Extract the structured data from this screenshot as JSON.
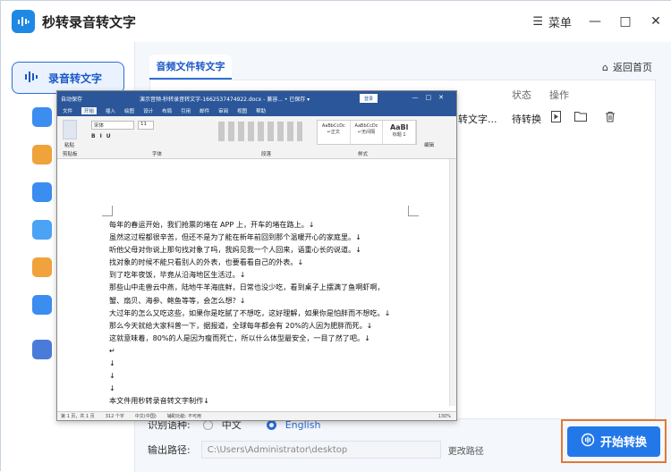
{
  "app": {
    "title": "秒转录音转文字",
    "menu_label": "菜单"
  },
  "window_controls": {
    "minimize": "—",
    "maximize": "□",
    "close": "✕"
  },
  "sidebar": {
    "active_label": "录音转文字"
  },
  "main": {
    "tab_label": "音频文件转文字",
    "home_label": "返回首页",
    "table": {
      "headers": {
        "status": "状态",
        "action": "操作"
      },
      "row": {
        "name": "转文字...",
        "status": "待转换"
      }
    },
    "language": {
      "label": "识别语种:",
      "options": [
        "中文",
        "English"
      ],
      "selected": "English"
    },
    "output": {
      "label": "输出路径:",
      "path": "C:\\Users\\Administrator\\desktop",
      "change": "更改路径"
    },
    "start_label": "开始转换"
  },
  "word": {
    "autosave": "自动保存",
    "doc_title": "演示音频-秒转录音转文字-1662537474922.docx - 兼容... • 已保存 ▾",
    "login": "登录",
    "menu": [
      "文件",
      "开始",
      "插入",
      "绘图",
      "设计",
      "布局",
      "引用",
      "邮件",
      "审阅",
      "视图",
      "帮助"
    ],
    "active_menu": "开始",
    "ribbon": {
      "paste": "粘贴",
      "font": "宋体",
      "size": "11",
      "groups": [
        "剪贴板",
        "字体",
        "段落",
        "样式",
        "编辑"
      ],
      "styles": [
        {
          "sample": "AaBbCcDc",
          "name": "↵正文"
        },
        {
          "sample": "AaBbCcDc",
          "name": "↵无间隔"
        },
        {
          "sample": "AaBl",
          "name": "标题 1"
        }
      ],
      "edit": "编辑"
    },
    "lines": [
      "每年的春运开始，我们抢票的堵在 APP 上，开车的堵在路上。↓",
      "虽然这过程都很辛苦，但还不是为了能在新年前回到那个温暖开心的家庭里。↓",
      "听他父母对你说上那句找对象了吗，我妈见我一个人回来，语重心长的说道。↓",
      "找对象的时候不能只看别人的外表，也要看看自己的外表。↓",
      "到了吃年夜饭，毕竟从沿海地区生活过。↓",
      "那些山中走兽云中燕，陆地牛羊海底鲜，日常也没少吃，看到桌子上摆满了鱼啊虾啊，",
      "蟹、扇贝、海参、鲍鱼等等，会怎么想？↓",
      "大过年的怎么又吃这些，如果你是吃腻了不想吃，这好理解，如果你是怕胖而不想吃。↓",
      "那么今天就给大家科普一下，据报道，全球每年都会有 20%的人因为肥胖而死。↓",
      "这就意味着，80%的人是因为瘦而死亡，所以什么体型最安全，一目了然了吧。↓",
      "↵",
      "↓",
      "↓",
      "↓",
      "本文件用秒转录音转文字制作↓"
    ],
    "status": {
      "page": "第 1 页，共 1 页",
      "words": "312 个字",
      "lang": "中文(中国)",
      "access": "辅助功能: 不可用",
      "zoom": "130%"
    }
  }
}
